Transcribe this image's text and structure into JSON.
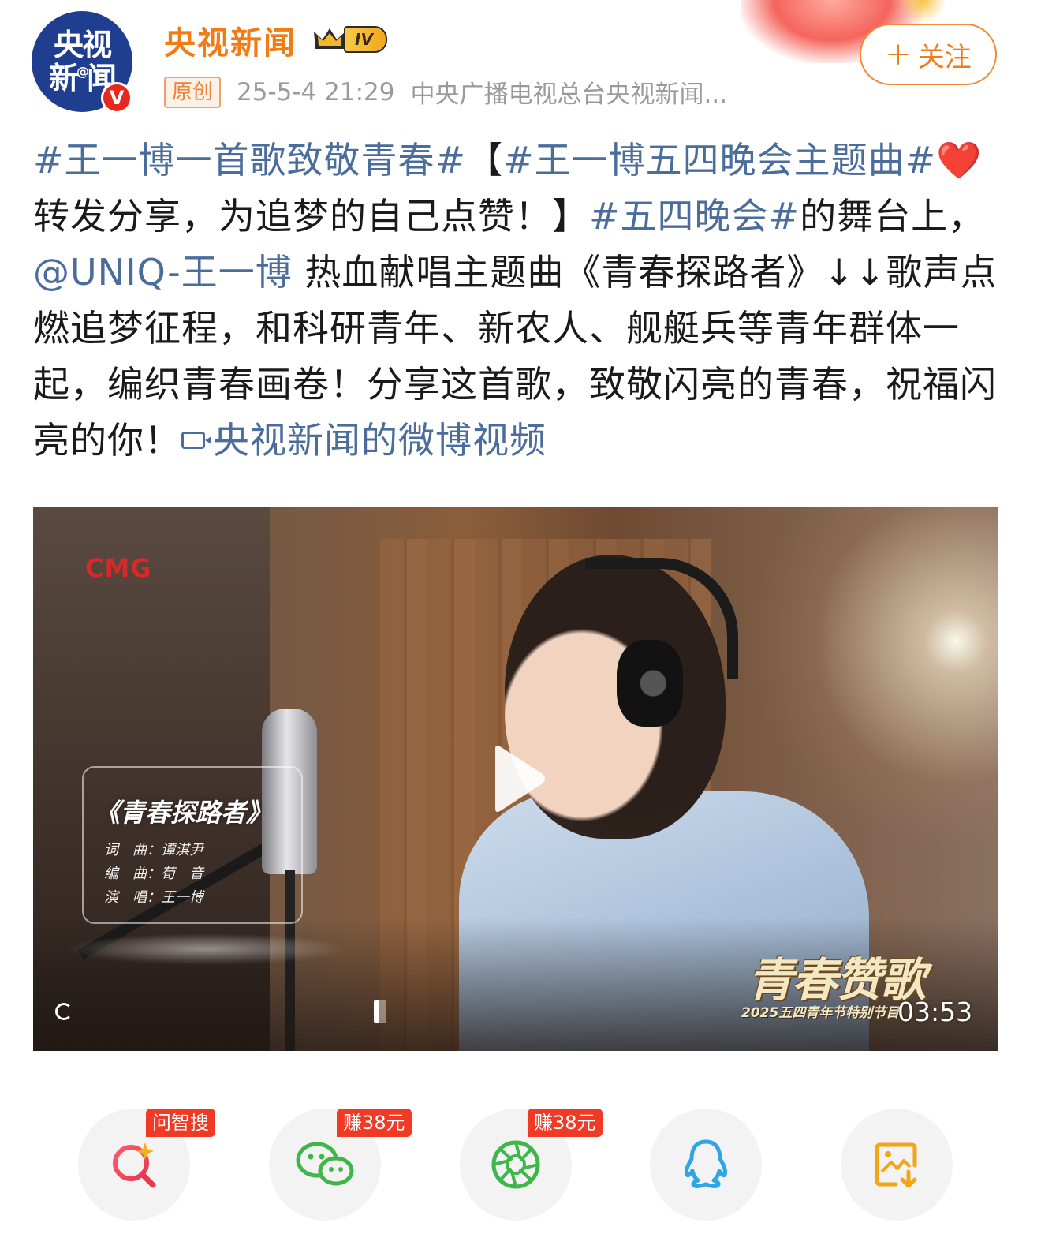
{
  "header": {
    "avatar_text_line1": "央视",
    "avatar_text_line2a": "新",
    "avatar_text_at": "@",
    "avatar_text_line2b": "闻",
    "verified_mark": "V",
    "author_name": "央视新闻",
    "level_label": "IV",
    "follow_plus": "+",
    "follow_label": "关注",
    "original_tag": "原创",
    "timestamp": "25-5-4 21:29",
    "source": "中央广播电视总台央视新闻..."
  },
  "post": {
    "hashtag1": "#王一博一首歌致敬青春#",
    "bracket_open": "【",
    "hashtag2": "#王一博五四晚会主题曲#",
    "heart": "❤️",
    "seg1": "转发分享，为追梦的自己点赞！】",
    "hashtag3": "#五四晚会#",
    "seg2": "的舞台上，",
    "mention": "@UNIQ-王一博",
    "seg3": " 热血献唱主题曲《青春探路者》↓↓歌声点燃追梦征程，和科研青年、新农人、舰艇兵等青年群体一起，编织青春画卷！分享这首歌，致敬闪亮的青春，祝福闪亮的你！",
    "video_link": "央视新闻的微博视频"
  },
  "video": {
    "logo": "CMG",
    "song_title": "《青春探路者》",
    "credit_lyrics": "词　曲：谭淇尹",
    "credit_arrange": "编　曲：荀　音",
    "credit_singer": "演　唱：王一博",
    "watermark_title": "青春赞歌",
    "watermark_subtitle": "2025五四青年节特别节目",
    "duration": "03:53"
  },
  "share": {
    "items": [
      {
        "badge": "问智搜",
        "icon": "ai-search-icon",
        "color": "#e8384f"
      },
      {
        "badge": "赚38元",
        "icon": "wechat-icon",
        "color": "#3fb64a"
      },
      {
        "badge": "赚38元",
        "icon": "moments-icon",
        "color": "#3fb64a"
      },
      {
        "badge": "",
        "icon": "qq-icon",
        "color": "#2fa4e7"
      },
      {
        "badge": "",
        "icon": "save-image-icon",
        "color": "#f2a516"
      }
    ]
  },
  "colors": {
    "accent_orange": "#f07c16",
    "link_blue": "#4a6d9c",
    "badge_red": "#f03a26"
  }
}
